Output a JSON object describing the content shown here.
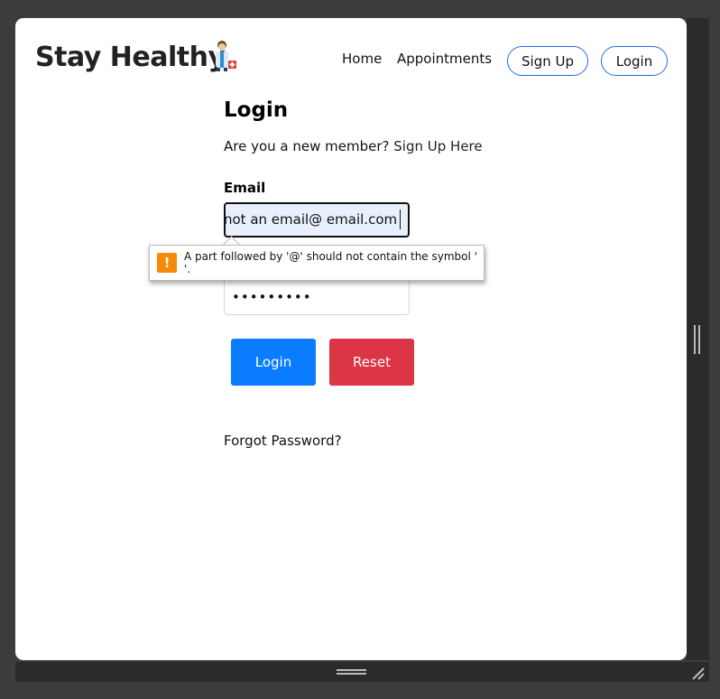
{
  "header": {
    "brand": "Stay Healthy",
    "nav": {
      "home": "Home",
      "appointments": "Appointments",
      "signup": "Sign Up",
      "login": "Login"
    }
  },
  "form": {
    "title": "Login",
    "new_member_text": "Are you a new member?",
    "signup_link": "Sign Up Here",
    "email_label": "Email",
    "email_value": "not an email@ email.com",
    "password_value": "•••••••••",
    "login_button": "Login",
    "reset_button": "Reset",
    "forgot_password": "Forgot Password?"
  },
  "validation": {
    "message": "A part followed by '@' should not contain the symbol ' '.",
    "icon": "warning-icon",
    "icon_color": "#f58a07"
  },
  "colors": {
    "primary": "#0a7cff",
    "danger": "#dc3545",
    "nav_border": "#1e6fe0"
  }
}
